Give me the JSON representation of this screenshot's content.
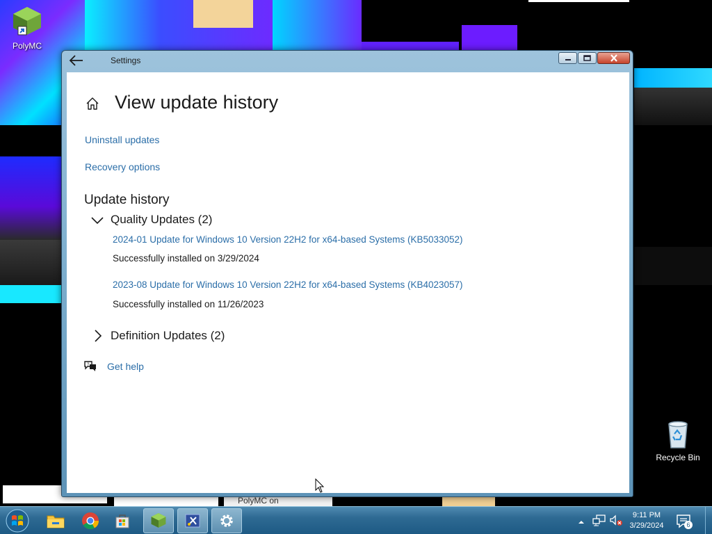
{
  "desktop": {
    "icons": [
      {
        "label": "PolyMC",
        "icon": "polymc-icon"
      },
      {
        "label": "Recycle Bin",
        "icon": "recycle-bin-icon"
      }
    ],
    "behind_text": "PolyMC on"
  },
  "window": {
    "title": "Settings",
    "back_icon": "back-arrow-icon",
    "controls": [
      "minimize",
      "maximize",
      "close"
    ]
  },
  "page": {
    "home_icon": "home-icon",
    "title": "View update history",
    "links": {
      "uninstall": "Uninstall updates",
      "recovery": "Recovery options"
    },
    "section_title": "Update history",
    "groups": [
      {
        "label": "Quality Updates (2)",
        "expanded": true,
        "items": [
          {
            "title": "2024-01 Update for Windows 10 Version 22H2 for x64-based Systems (KB5033052)",
            "status": "Successfully installed on 3/29/2024"
          },
          {
            "title": "2023-08 Update for Windows 10 Version 22H2 for x64-based Systems (KB4023057)",
            "status": "Successfully installed on 11/26/2023"
          }
        ]
      },
      {
        "label": "Definition Updates (2)",
        "expanded": false
      }
    ],
    "help_link": "Get help"
  },
  "taskbar": {
    "pinned": [
      "start-orb",
      "file-explorer",
      "chrome",
      "store",
      "polymc",
      "snipping-tool",
      "settings"
    ],
    "active": "settings",
    "clock": {
      "time": "9:11 PM",
      "date": "3/29/2024"
    },
    "notifications_count": "6",
    "tray_icons": [
      "show-hidden-icons",
      "network-icon",
      "volume-muted-icon",
      "action-center-icon"
    ]
  },
  "colors": {
    "link": "#2b6ea8",
    "taskbar": "#2e6a93",
    "window_frame": "#7fb0cf"
  }
}
